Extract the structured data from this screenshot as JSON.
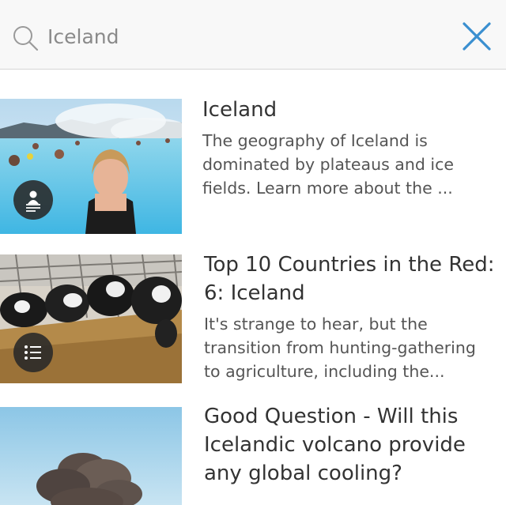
{
  "search": {
    "value": "Iceland",
    "placeholder": "Search"
  },
  "results": [
    {
      "title": "Iceland",
      "snippet": "The geography of Iceland is dominated by plateaus and ice fields. Learn more about the ...",
      "type_icon": "article-icon"
    },
    {
      "title": "Top 10 Countries in the Red: 6: Iceland",
      "snippet": "It's strange to hear, but the transition from hunting-gathering to agriculture, including the...",
      "type_icon": "list-icon"
    },
    {
      "title": "Good Question - Will this Icelandic volcano provide any global cooling?",
      "snippet": "",
      "type_icon": ""
    }
  ],
  "colors": {
    "accent": "#3a8fd0",
    "search_bar_bg": "#f8f8f8",
    "badge_bg": "#2b2b2b"
  }
}
